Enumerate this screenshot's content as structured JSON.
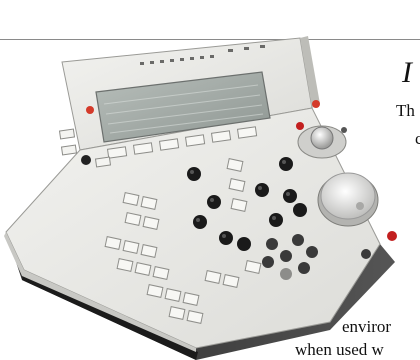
{
  "text": {
    "headline_fragment": "I",
    "body_line_1": "Th",
    "body_line_2": "c",
    "body_line_3": "enviror",
    "body_line_4": "when used w"
  },
  "colors": {
    "panel": "#ebebe8",
    "bezel": "#c9c9c5",
    "display": "#9aa39f",
    "knob": "#1a1a1a",
    "red_accent": "#c21f1f",
    "jog_wheel": "#dcdcda"
  },
  "product": {
    "name_icon": "control-surface-photo"
  }
}
